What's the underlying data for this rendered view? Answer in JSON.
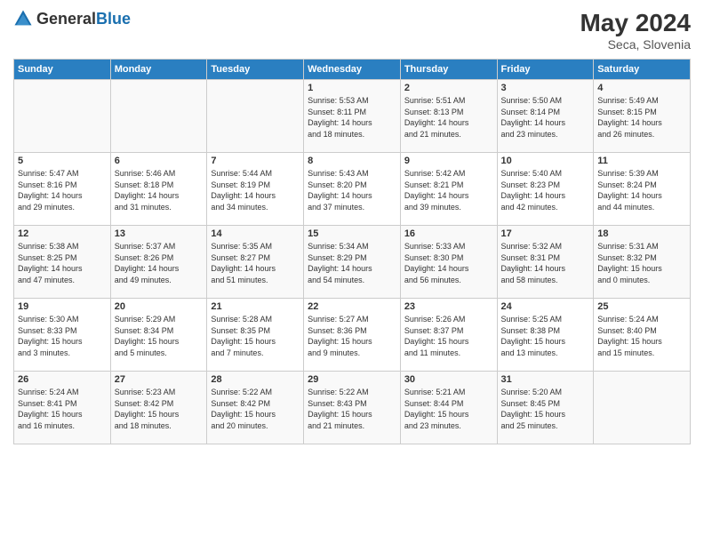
{
  "header": {
    "logo_general": "General",
    "logo_blue": "Blue",
    "month_year": "May 2024",
    "location": "Seca, Slovenia"
  },
  "days_of_week": [
    "Sunday",
    "Monday",
    "Tuesday",
    "Wednesday",
    "Thursday",
    "Friday",
    "Saturday"
  ],
  "weeks": [
    [
      {
        "day": "",
        "info": ""
      },
      {
        "day": "",
        "info": ""
      },
      {
        "day": "",
        "info": ""
      },
      {
        "day": "1",
        "info": "Sunrise: 5:53 AM\nSunset: 8:11 PM\nDaylight: 14 hours\nand 18 minutes."
      },
      {
        "day": "2",
        "info": "Sunrise: 5:51 AM\nSunset: 8:13 PM\nDaylight: 14 hours\nand 21 minutes."
      },
      {
        "day": "3",
        "info": "Sunrise: 5:50 AM\nSunset: 8:14 PM\nDaylight: 14 hours\nand 23 minutes."
      },
      {
        "day": "4",
        "info": "Sunrise: 5:49 AM\nSunset: 8:15 PM\nDaylight: 14 hours\nand 26 minutes."
      }
    ],
    [
      {
        "day": "5",
        "info": "Sunrise: 5:47 AM\nSunset: 8:16 PM\nDaylight: 14 hours\nand 29 minutes."
      },
      {
        "day": "6",
        "info": "Sunrise: 5:46 AM\nSunset: 8:18 PM\nDaylight: 14 hours\nand 31 minutes."
      },
      {
        "day": "7",
        "info": "Sunrise: 5:44 AM\nSunset: 8:19 PM\nDaylight: 14 hours\nand 34 minutes."
      },
      {
        "day": "8",
        "info": "Sunrise: 5:43 AM\nSunset: 8:20 PM\nDaylight: 14 hours\nand 37 minutes."
      },
      {
        "day": "9",
        "info": "Sunrise: 5:42 AM\nSunset: 8:21 PM\nDaylight: 14 hours\nand 39 minutes."
      },
      {
        "day": "10",
        "info": "Sunrise: 5:40 AM\nSunset: 8:23 PM\nDaylight: 14 hours\nand 42 minutes."
      },
      {
        "day": "11",
        "info": "Sunrise: 5:39 AM\nSunset: 8:24 PM\nDaylight: 14 hours\nand 44 minutes."
      }
    ],
    [
      {
        "day": "12",
        "info": "Sunrise: 5:38 AM\nSunset: 8:25 PM\nDaylight: 14 hours\nand 47 minutes."
      },
      {
        "day": "13",
        "info": "Sunrise: 5:37 AM\nSunset: 8:26 PM\nDaylight: 14 hours\nand 49 minutes."
      },
      {
        "day": "14",
        "info": "Sunrise: 5:35 AM\nSunset: 8:27 PM\nDaylight: 14 hours\nand 51 minutes."
      },
      {
        "day": "15",
        "info": "Sunrise: 5:34 AM\nSunset: 8:29 PM\nDaylight: 14 hours\nand 54 minutes."
      },
      {
        "day": "16",
        "info": "Sunrise: 5:33 AM\nSunset: 8:30 PM\nDaylight: 14 hours\nand 56 minutes."
      },
      {
        "day": "17",
        "info": "Sunrise: 5:32 AM\nSunset: 8:31 PM\nDaylight: 14 hours\nand 58 minutes."
      },
      {
        "day": "18",
        "info": "Sunrise: 5:31 AM\nSunset: 8:32 PM\nDaylight: 15 hours\nand 0 minutes."
      }
    ],
    [
      {
        "day": "19",
        "info": "Sunrise: 5:30 AM\nSunset: 8:33 PM\nDaylight: 15 hours\nand 3 minutes."
      },
      {
        "day": "20",
        "info": "Sunrise: 5:29 AM\nSunset: 8:34 PM\nDaylight: 15 hours\nand 5 minutes."
      },
      {
        "day": "21",
        "info": "Sunrise: 5:28 AM\nSunset: 8:35 PM\nDaylight: 15 hours\nand 7 minutes."
      },
      {
        "day": "22",
        "info": "Sunrise: 5:27 AM\nSunset: 8:36 PM\nDaylight: 15 hours\nand 9 minutes."
      },
      {
        "day": "23",
        "info": "Sunrise: 5:26 AM\nSunset: 8:37 PM\nDaylight: 15 hours\nand 11 minutes."
      },
      {
        "day": "24",
        "info": "Sunrise: 5:25 AM\nSunset: 8:38 PM\nDaylight: 15 hours\nand 13 minutes."
      },
      {
        "day": "25",
        "info": "Sunrise: 5:24 AM\nSunset: 8:40 PM\nDaylight: 15 hours\nand 15 minutes."
      }
    ],
    [
      {
        "day": "26",
        "info": "Sunrise: 5:24 AM\nSunset: 8:41 PM\nDaylight: 15 hours\nand 16 minutes."
      },
      {
        "day": "27",
        "info": "Sunrise: 5:23 AM\nSunset: 8:42 PM\nDaylight: 15 hours\nand 18 minutes."
      },
      {
        "day": "28",
        "info": "Sunrise: 5:22 AM\nSunset: 8:42 PM\nDaylight: 15 hours\nand 20 minutes."
      },
      {
        "day": "29",
        "info": "Sunrise: 5:22 AM\nSunset: 8:43 PM\nDaylight: 15 hours\nand 21 minutes."
      },
      {
        "day": "30",
        "info": "Sunrise: 5:21 AM\nSunset: 8:44 PM\nDaylight: 15 hours\nand 23 minutes."
      },
      {
        "day": "31",
        "info": "Sunrise: 5:20 AM\nSunset: 8:45 PM\nDaylight: 15 hours\nand 25 minutes."
      },
      {
        "day": "",
        "info": ""
      }
    ]
  ]
}
